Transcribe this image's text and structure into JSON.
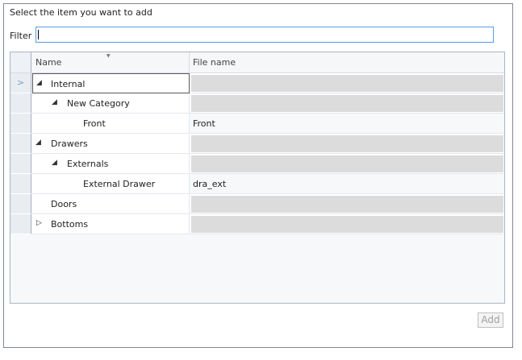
{
  "dialog": {
    "prompt": "Select the item you want to add",
    "filter_label": "Filter",
    "filter_value": ""
  },
  "grid": {
    "columns": [
      "Name",
      "File name"
    ],
    "rows": [
      {
        "name": "Internal",
        "file": "",
        "expander": "expanded"
      },
      {
        "name": "New Category",
        "file": "",
        "expander": "expanded"
      },
      {
        "name": "Front",
        "file": "Front",
        "expander": "none"
      },
      {
        "name": "Drawers",
        "file": "",
        "expander": "expanded"
      },
      {
        "name": "Externals",
        "file": "",
        "expander": "expanded"
      },
      {
        "name": "External Drawer",
        "file": "dra_ext",
        "expander": "none"
      },
      {
        "name": "Doors",
        "file": "",
        "expander": "none"
      },
      {
        "name": "Bottoms",
        "file": "",
        "expander": "collapsed"
      }
    ]
  },
  "buttons": {
    "add": "Add"
  },
  "colors": {
    "accent": "#569de5",
    "empty_cell": "#dcdcdc",
    "row_header": "#e9edf2"
  }
}
